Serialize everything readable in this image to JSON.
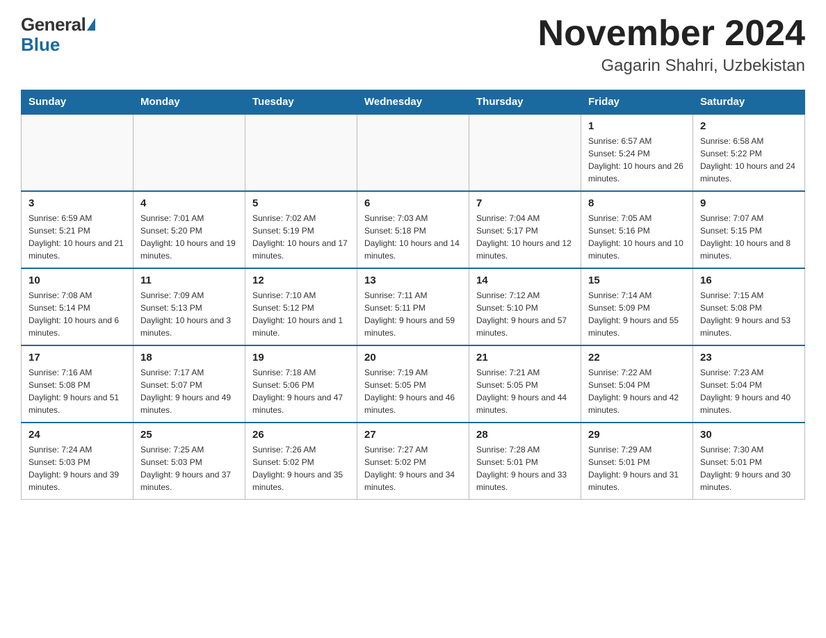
{
  "logo": {
    "general": "General",
    "blue": "Blue"
  },
  "title": "November 2024",
  "subtitle": "Gagarin Shahri, Uzbekistan",
  "weekdays": [
    "Sunday",
    "Monday",
    "Tuesday",
    "Wednesday",
    "Thursday",
    "Friday",
    "Saturday"
  ],
  "weeks": [
    [
      {
        "day": "",
        "info": ""
      },
      {
        "day": "",
        "info": ""
      },
      {
        "day": "",
        "info": ""
      },
      {
        "day": "",
        "info": ""
      },
      {
        "day": "",
        "info": ""
      },
      {
        "day": "1",
        "info": "Sunrise: 6:57 AM\nSunset: 5:24 PM\nDaylight: 10 hours and 26 minutes."
      },
      {
        "day": "2",
        "info": "Sunrise: 6:58 AM\nSunset: 5:22 PM\nDaylight: 10 hours and 24 minutes."
      }
    ],
    [
      {
        "day": "3",
        "info": "Sunrise: 6:59 AM\nSunset: 5:21 PM\nDaylight: 10 hours and 21 minutes."
      },
      {
        "day": "4",
        "info": "Sunrise: 7:01 AM\nSunset: 5:20 PM\nDaylight: 10 hours and 19 minutes."
      },
      {
        "day": "5",
        "info": "Sunrise: 7:02 AM\nSunset: 5:19 PM\nDaylight: 10 hours and 17 minutes."
      },
      {
        "day": "6",
        "info": "Sunrise: 7:03 AM\nSunset: 5:18 PM\nDaylight: 10 hours and 14 minutes."
      },
      {
        "day": "7",
        "info": "Sunrise: 7:04 AM\nSunset: 5:17 PM\nDaylight: 10 hours and 12 minutes."
      },
      {
        "day": "8",
        "info": "Sunrise: 7:05 AM\nSunset: 5:16 PM\nDaylight: 10 hours and 10 minutes."
      },
      {
        "day": "9",
        "info": "Sunrise: 7:07 AM\nSunset: 5:15 PM\nDaylight: 10 hours and 8 minutes."
      }
    ],
    [
      {
        "day": "10",
        "info": "Sunrise: 7:08 AM\nSunset: 5:14 PM\nDaylight: 10 hours and 6 minutes."
      },
      {
        "day": "11",
        "info": "Sunrise: 7:09 AM\nSunset: 5:13 PM\nDaylight: 10 hours and 3 minutes."
      },
      {
        "day": "12",
        "info": "Sunrise: 7:10 AM\nSunset: 5:12 PM\nDaylight: 10 hours and 1 minute."
      },
      {
        "day": "13",
        "info": "Sunrise: 7:11 AM\nSunset: 5:11 PM\nDaylight: 9 hours and 59 minutes."
      },
      {
        "day": "14",
        "info": "Sunrise: 7:12 AM\nSunset: 5:10 PM\nDaylight: 9 hours and 57 minutes."
      },
      {
        "day": "15",
        "info": "Sunrise: 7:14 AM\nSunset: 5:09 PM\nDaylight: 9 hours and 55 minutes."
      },
      {
        "day": "16",
        "info": "Sunrise: 7:15 AM\nSunset: 5:08 PM\nDaylight: 9 hours and 53 minutes."
      }
    ],
    [
      {
        "day": "17",
        "info": "Sunrise: 7:16 AM\nSunset: 5:08 PM\nDaylight: 9 hours and 51 minutes."
      },
      {
        "day": "18",
        "info": "Sunrise: 7:17 AM\nSunset: 5:07 PM\nDaylight: 9 hours and 49 minutes."
      },
      {
        "day": "19",
        "info": "Sunrise: 7:18 AM\nSunset: 5:06 PM\nDaylight: 9 hours and 47 minutes."
      },
      {
        "day": "20",
        "info": "Sunrise: 7:19 AM\nSunset: 5:05 PM\nDaylight: 9 hours and 46 minutes."
      },
      {
        "day": "21",
        "info": "Sunrise: 7:21 AM\nSunset: 5:05 PM\nDaylight: 9 hours and 44 minutes."
      },
      {
        "day": "22",
        "info": "Sunrise: 7:22 AM\nSunset: 5:04 PM\nDaylight: 9 hours and 42 minutes."
      },
      {
        "day": "23",
        "info": "Sunrise: 7:23 AM\nSunset: 5:04 PM\nDaylight: 9 hours and 40 minutes."
      }
    ],
    [
      {
        "day": "24",
        "info": "Sunrise: 7:24 AM\nSunset: 5:03 PM\nDaylight: 9 hours and 39 minutes."
      },
      {
        "day": "25",
        "info": "Sunrise: 7:25 AM\nSunset: 5:03 PM\nDaylight: 9 hours and 37 minutes."
      },
      {
        "day": "26",
        "info": "Sunrise: 7:26 AM\nSunset: 5:02 PM\nDaylight: 9 hours and 35 minutes."
      },
      {
        "day": "27",
        "info": "Sunrise: 7:27 AM\nSunset: 5:02 PM\nDaylight: 9 hours and 34 minutes."
      },
      {
        "day": "28",
        "info": "Sunrise: 7:28 AM\nSunset: 5:01 PM\nDaylight: 9 hours and 33 minutes."
      },
      {
        "day": "29",
        "info": "Sunrise: 7:29 AM\nSunset: 5:01 PM\nDaylight: 9 hours and 31 minutes."
      },
      {
        "day": "30",
        "info": "Sunrise: 7:30 AM\nSunset: 5:01 PM\nDaylight: 9 hours and 30 minutes."
      }
    ]
  ]
}
